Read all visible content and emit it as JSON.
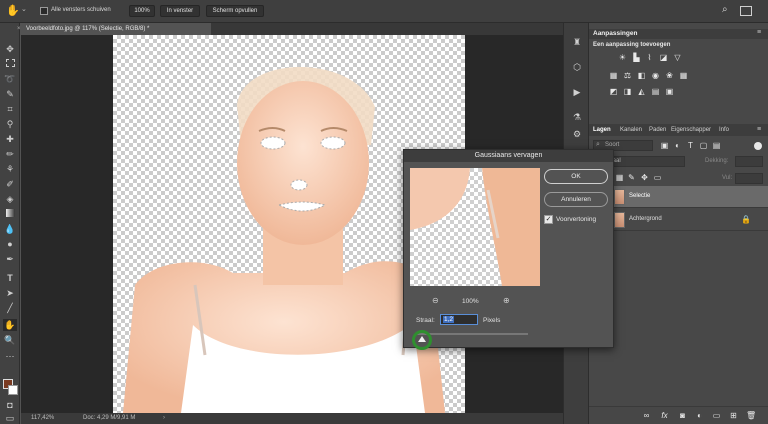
{
  "options_bar": {
    "scroll_all_label": "Alle vensters schuiven",
    "zoom_value": "100%",
    "fit_screen_label": "In venster",
    "fill_screen_label": "Scherm opvullen"
  },
  "document": {
    "tab_title": "Voorbeeldfoto.jpg @ 117% (Selectie, RGB/8) *"
  },
  "status_bar": {
    "zoom": "117,42%",
    "doc_size": "Doc: 4,29 M/9,91 M"
  },
  "adjustments_panel": {
    "title": "Aanpassingen",
    "subtitle": "Een aanpassing toevoegen"
  },
  "layers_panel": {
    "tabs": [
      "Lagen",
      "Kanalen",
      "Paden",
      "Eigenschapper",
      "Info"
    ],
    "filter_placeholder": "Soort",
    "blend_mode": "Normaal",
    "opacity_label": "Dekking:",
    "fill_label": "Vul:",
    "layers": [
      {
        "name": "Selectie",
        "selected": true
      },
      {
        "name": "Achtergrond",
        "selected": false
      }
    ]
  },
  "dialog": {
    "title": "Gaussiaans vervagen",
    "ok_label": "OK",
    "cancel_label": "Annuleren",
    "preview_label": "Voorvertoning",
    "preview_checked": true,
    "zoom_level": "100%",
    "radius_label": "Straal:",
    "radius_value": "1,2",
    "radius_unit": "Pixels"
  },
  "colors": {
    "highlight_ring": "#2f8f2f",
    "foreground_swatch": "#7a3b22",
    "background_swatch": "#ffffff"
  }
}
